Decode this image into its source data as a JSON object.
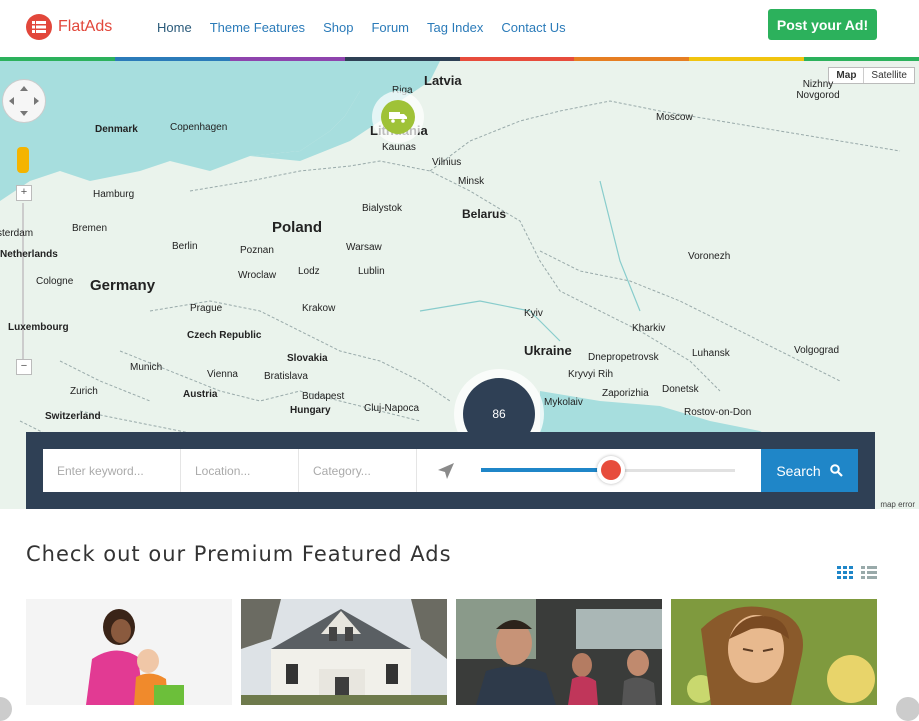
{
  "brand": {
    "name": "FlatAds",
    "accent": "#e2473b"
  },
  "nav": {
    "items": [
      {
        "label": "Home"
      },
      {
        "label": "Theme Features"
      },
      {
        "label": "Shop"
      },
      {
        "label": "Forum"
      },
      {
        "label": "Tag Index"
      },
      {
        "label": "Contact Us"
      }
    ],
    "active": "Home",
    "post_button": "Post your Ad!"
  },
  "strip_colors": [
    "#2cb15c",
    "#2b7bb9",
    "#8e44ad",
    "#2f4055",
    "#e74c3c",
    "#e67e22",
    "#f1c40f",
    "#2cb15c"
  ],
  "map": {
    "type_options": [
      "Map",
      "Satellite"
    ],
    "selected_type": "Map",
    "cluster_count": "86",
    "error_text": "map error",
    "countries": [
      "Latvia",
      "Poland",
      "Belarus",
      "Germany",
      "Ukraine",
      "Czech Republic",
      "Slovakia",
      "Austria",
      "Hungary",
      "Switzerland",
      "Netherlands",
      "Luxembourg"
    ],
    "cities": [
      "Riga",
      "Nizhny Novgorod",
      "Denmark",
      "Copenhagen",
      "Moscow",
      "Kaunas",
      "Vilnius",
      "Minsk",
      "Hamburg",
      "Bremen",
      "Berlin",
      "Poznan",
      "Bialystok",
      "Warsaw",
      "Amsterdam",
      "Cologne",
      "Wroclaw",
      "Lodz",
      "Lublin",
      "Voronezh",
      "Prague",
      "Krakow",
      "Kyiv",
      "Kharkiv",
      "Munich",
      "Vienna",
      "Bratislava",
      "Dnepropetrovsk",
      "Luhansk",
      "Volgograd",
      "Zurich",
      "Kryvyi Rih",
      "Zaporizhia",
      "Donetsk",
      "Budapest",
      "Cluj-Napoca",
      "Mykolaiv",
      "Rostov-on-Don",
      "Lithuania"
    ]
  },
  "search": {
    "keyword_placeholder": "Enter keyword...",
    "location_placeholder": "Location...",
    "category_placeholder": "Category...",
    "radius_fraction": 0.51,
    "button_label": "Search"
  },
  "featured": {
    "title": "Check out our Premium Featured Ads",
    "view_modes": [
      "grid-view-icon",
      "list-view-icon"
    ],
    "selected_view": "grid-view-icon",
    "ads": [
      {
        "image": "woman-with-child"
      },
      {
        "image": "victorian-house"
      },
      {
        "image": "men-in-car"
      },
      {
        "image": "young-woman-portrait"
      }
    ]
  }
}
